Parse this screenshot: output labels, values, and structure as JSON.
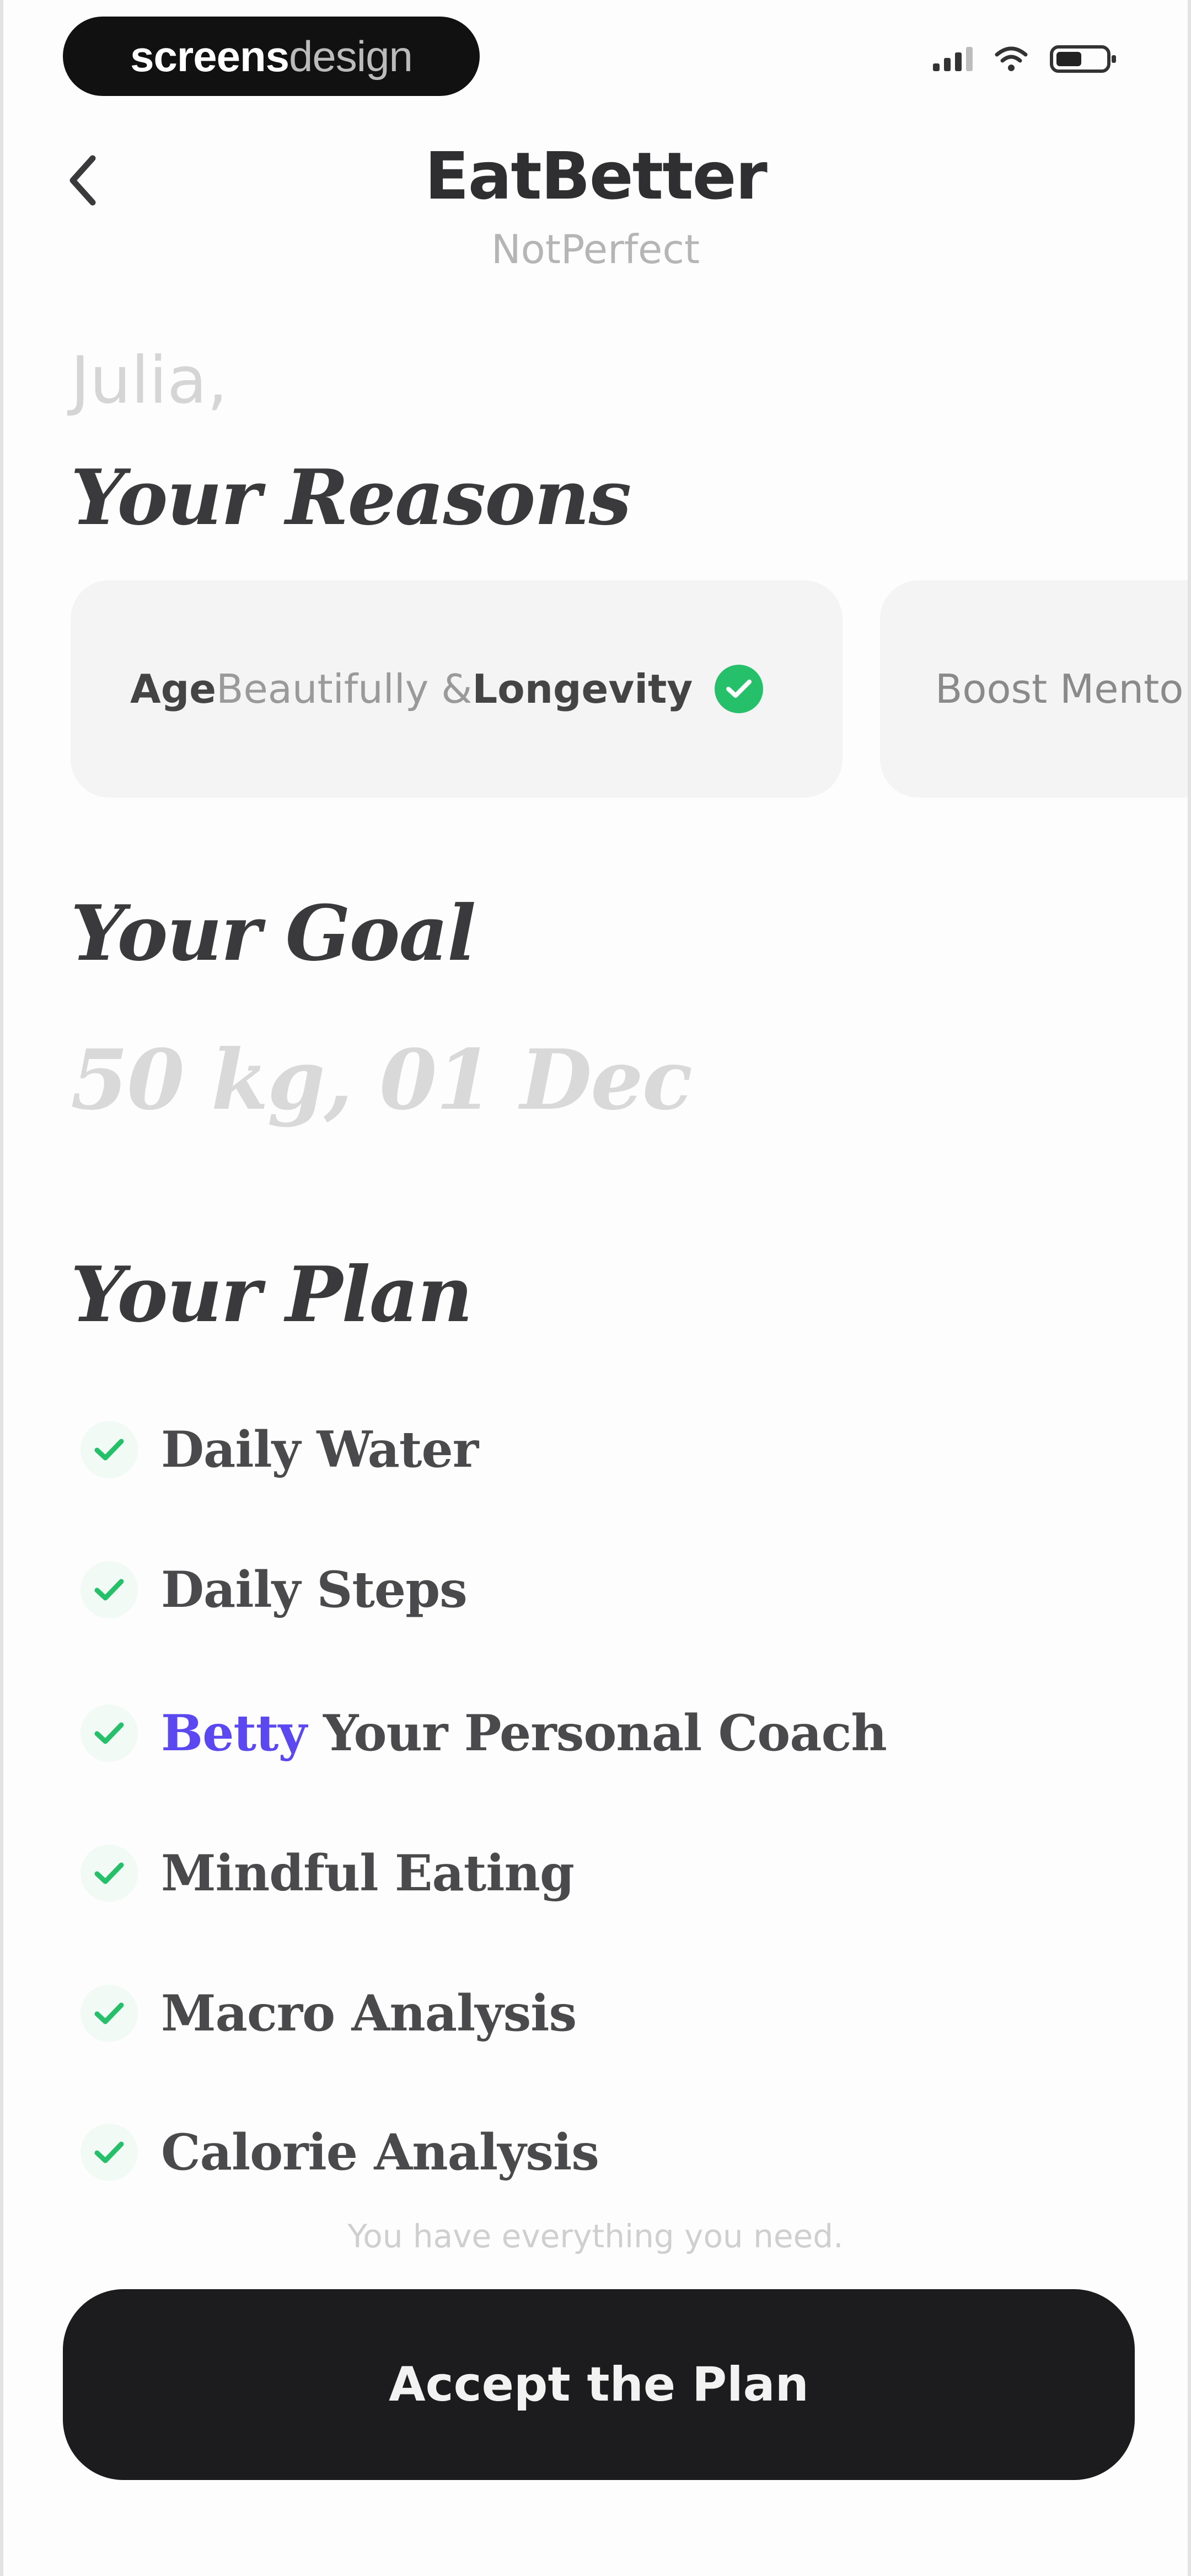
{
  "status_bar": {
    "brand_left": "screens",
    "brand_right": "design",
    "icons": [
      "signal-icon",
      "wifi-icon",
      "battery-icon"
    ]
  },
  "header": {
    "back_icon": "chevron-left-icon",
    "title": "EatBetter",
    "subtitle": "NotPerfect"
  },
  "greeting": "Julia,",
  "reasons": {
    "heading": "Your Reasons",
    "cards": [
      {
        "prefix": "Age",
        "middle": " Beautifully & ",
        "suffix": "Longevity",
        "selected": true
      },
      {
        "label": "Boost Mento",
        "selected": false
      }
    ]
  },
  "goal": {
    "heading": "Your Goal",
    "value": "50 kg, 01 Dec"
  },
  "plan": {
    "heading": "Your Plan",
    "items": [
      {
        "label": "Daily Water"
      },
      {
        "label": "Daily Steps"
      },
      {
        "highlight": "Betty",
        "label": " Your Personal Coach"
      },
      {
        "label": "Mindful Eating"
      },
      {
        "label": "Macro Analysis"
      },
      {
        "label": "Calorie Analysis"
      }
    ]
  },
  "note": "You have everything you need.",
  "cta": {
    "label": "Accept the Plan"
  },
  "colors": {
    "accent": "#5b48f0",
    "success": "#26c06a",
    "button": "#1c1c1e"
  }
}
